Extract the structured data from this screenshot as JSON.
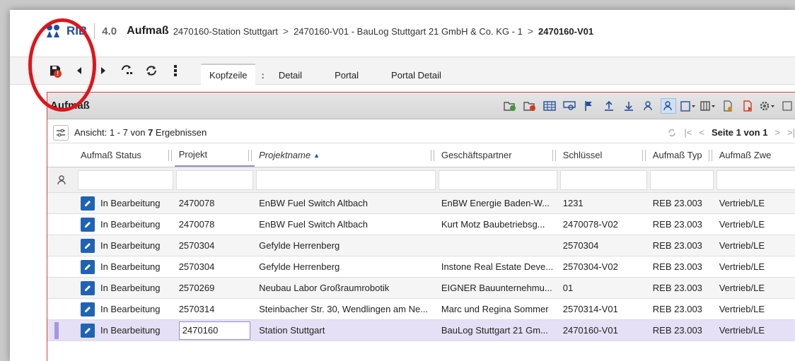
{
  "header": {
    "logo_text": "RIB",
    "version": "4.0",
    "module": "Aufmaß",
    "breadcrumb": [
      "2470160-Station Stuttgart",
      "2470160-V01 - BauLog Stuttgart 21 GmbH & Co. KG - 1",
      "2470160-V01"
    ],
    "separator": ">"
  },
  "toolbar": {
    "icons": [
      "save-warning-icon",
      "previous-icon",
      "next-icon",
      "refresh-selection-icon",
      "refresh-icon",
      "more-vertical-icon"
    ],
    "tabs": [
      {
        "label": "Kopfzeile",
        "active": true
      },
      {
        "label": ":",
        "active": false
      },
      {
        "label": "Detail",
        "active": false
      },
      {
        "label": "Portal",
        "active": false
      },
      {
        "label": "Portal Detail",
        "active": false
      }
    ]
  },
  "panel": {
    "title": "Aufmaß",
    "view_text_prefix": "Ansicht: 1 - 7 von ",
    "view_count": "7",
    "view_text_suffix": " Ergebnissen",
    "page_label": "Seite 1 von 1"
  },
  "grid": {
    "columns": [
      "Aufmaß Status",
      "Projekt",
      "Projektname",
      "Geschäftspartner",
      "Schlüssel",
      "Aufmaß Typ",
      "Aufmaß Zwe"
    ],
    "rows": [
      [
        "In Bearbeitung",
        "2470078",
        "EnBW Fuel Switch Altbach",
        "EnBW Energie Baden-W...",
        "1231",
        "REB 23.003",
        "Vertrieb/LE"
      ],
      [
        "In Bearbeitung",
        "2470078",
        "EnBW Fuel Switch Altbach",
        "Kurt Motz Baubetriebsg...",
        "2470078-V02",
        "REB 23.003",
        "Vertrieb/LE"
      ],
      [
        "In Bearbeitung",
        "2570304",
        "Gefylde Herrenberg",
        "",
        "2570304",
        "REB 23.003",
        "Vertrieb/LE"
      ],
      [
        "In Bearbeitung",
        "2570304",
        "Gefylde Herrenberg",
        "Instone Real Estate Deve...",
        "2570304-V02",
        "REB 23.003",
        "Vertrieb/LE"
      ],
      [
        "In Bearbeitung",
        "2570269",
        "Neubau Labor Großraumrobotik",
        "EIGNER Bauunternehmu...",
        "01",
        "REB 23.003",
        "Vertrieb/LE"
      ],
      [
        "In Bearbeitung",
        "2570314",
        "Steinbacher Str. 30, Wendlingen am Ne...",
        "Marc und Regina Sommer",
        "2570314-V01",
        "REB 23.003",
        "Vertrieb/LE"
      ],
      [
        "In Bearbeitung",
        "2470160",
        "Station Stuttgart",
        "BauLog Stuttgart 21 Gm...",
        "2470160-V01",
        "REB 23.003",
        "Vertrieb/LE"
      ]
    ],
    "selected_row": 6
  },
  "colors": {
    "brand": "#1f4e9c",
    "annotation": "#e0141a",
    "selection": "#e5e0f5",
    "status_icon": "#1f63b5"
  }
}
